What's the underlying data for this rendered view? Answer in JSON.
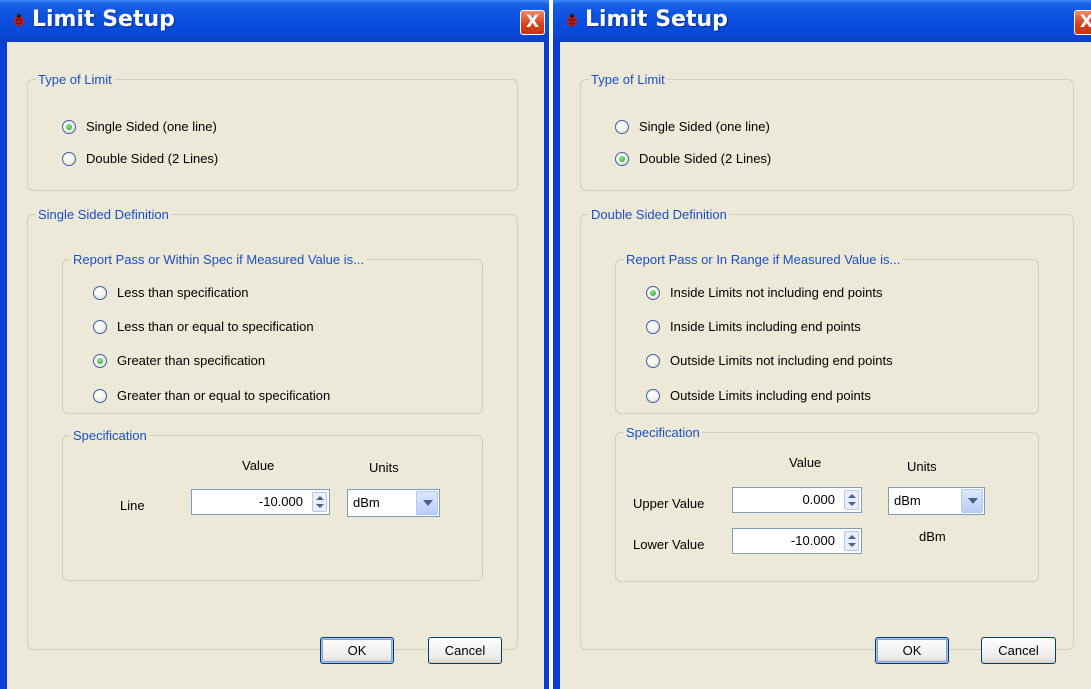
{
  "left_window": {
    "title": "Limit Setup",
    "close_label": "X",
    "type_of_limit": {
      "legend": "Type of Limit",
      "options": [
        "Single Sided (one line)",
        "Double Sided (2 Lines)"
      ],
      "selected": 0
    },
    "definition": {
      "legend": "Single Sided Definition",
      "report": {
        "legend": "Report Pass or Within Spec if Measured Value is...",
        "options": [
          "Less than specification",
          "Less than or equal to specification",
          "Greater than specification",
          "Greater than or equal to specification"
        ],
        "selected": 2
      },
      "specification": {
        "legend": "Specification",
        "value_header": "Value",
        "units_header": "Units",
        "line_label": "Line",
        "line_value": "-10.000",
        "units_value": "dBm"
      }
    },
    "ok_label": "OK",
    "cancel_label": "Cancel"
  },
  "right_window": {
    "title": "Limit Setup",
    "close_label": "X",
    "type_of_limit": {
      "legend": "Type of Limit",
      "options": [
        "Single Sided (one line)",
        "Double Sided (2 Lines)"
      ],
      "selected": 1
    },
    "definition": {
      "legend": "Double Sided Definition",
      "report": {
        "legend": "Report Pass or In Range if Measured Value is...",
        "options": [
          "Inside Limits not including end points",
          "Inside Limits including end points",
          "Outside Limits not including end points",
          "Outside Limits including end points"
        ],
        "selected": 0
      },
      "specification": {
        "legend": "Specification",
        "value_header": "Value",
        "units_header": "Units",
        "upper_label": "Upper Value",
        "upper_value": "0.000",
        "lower_label": "Lower Value",
        "lower_value": "-10.000",
        "units_value": "dBm",
        "lower_units": "dBm"
      }
    },
    "ok_label": "OK",
    "cancel_label": "Cancel"
  },
  "colors": {
    "title_bar": "#0b50df",
    "dialog_bg": "#ece9d8",
    "group_legend": "#1c4ec8",
    "close_button": "#d8431e",
    "radio_selected": "#21a121"
  },
  "icons": {
    "app": "ladybug-icon",
    "close": "close-icon",
    "spin_up": "spin-up-icon",
    "spin_down": "spin-down-icon",
    "dropdown": "chevron-down-icon"
  }
}
